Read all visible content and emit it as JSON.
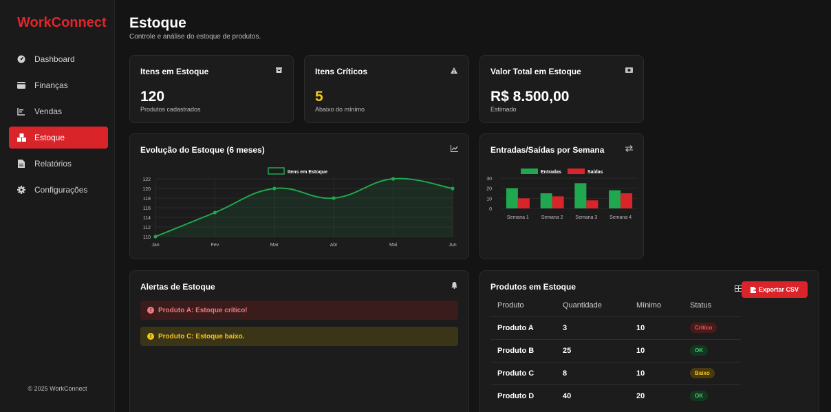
{
  "brand": "WorkConnect",
  "sidebar": {
    "items": [
      {
        "label": "Dashboard",
        "icon": "gauge-icon",
        "active": false
      },
      {
        "label": "Finanças",
        "icon": "wallet-icon",
        "active": false
      },
      {
        "label": "Vendas",
        "icon": "chart-icon",
        "active": false
      },
      {
        "label": "Estoque",
        "icon": "boxes-icon",
        "active": true
      },
      {
        "label": "Relatórios",
        "icon": "file-icon",
        "active": false
      },
      {
        "label": "Configurações",
        "icon": "gear-icon",
        "active": false
      }
    ],
    "footer": "© 2025 WorkConnect"
  },
  "header": {
    "title": "Estoque",
    "subtitle": "Controle e análise do estoque de produtos."
  },
  "kpis": [
    {
      "title": "Itens em Estoque",
      "value": "120",
      "sub": "Produtos cadastrados",
      "icon": "box-icon",
      "value_color": "#ffffff"
    },
    {
      "title": "Itens Críticos",
      "value": "5",
      "sub": "Abaixo do mínimo",
      "icon": "warning-icon",
      "value_color": "#f5c518"
    },
    {
      "title": "Valor Total em Estoque",
      "value": "R$ 8.500,00",
      "sub": "Estimado",
      "icon": "money-icon",
      "value_color": "#ffffff"
    }
  ],
  "evolution": {
    "title": "Evolução do Estoque (6 meses)",
    "icon": "line-chart-icon"
  },
  "weekly": {
    "title": "Entradas/Saídas por Semana",
    "icon": "exchange-icon"
  },
  "chart_data": [
    {
      "type": "area",
      "title": "Evolução do Estoque (6 meses)",
      "categories": [
        "Jan",
        "Fev",
        "Mar",
        "Abr",
        "Mai",
        "Jun"
      ],
      "series": [
        {
          "name": "Itens em Estoque",
          "values": [
            110,
            115,
            120,
            118,
            122,
            120
          ],
          "color": "#1fa84f"
        }
      ],
      "ylim": [
        110,
        122
      ],
      "yticks": [
        110,
        112,
        114,
        116,
        118,
        120,
        122
      ],
      "legend": "top-center",
      "grid": true
    },
    {
      "type": "bar",
      "title": "Entradas/Saídas por Semana",
      "categories": [
        "Semana 1",
        "Semana 2",
        "Semana 3",
        "Semana 4"
      ],
      "series": [
        {
          "name": "Entradas",
          "values": [
            20,
            15,
            25,
            18
          ],
          "color": "#1fa84f"
        },
        {
          "name": "Saídas",
          "values": [
            10,
            12,
            8,
            15
          ],
          "color": "#d9242a"
        }
      ],
      "ylim": [
        0,
        30
      ],
      "yticks": [
        0,
        10,
        20,
        30
      ],
      "legend": "top-center",
      "grid": true
    }
  ],
  "alerts": {
    "title": "Alertas de Estoque",
    "icon": "bell-icon",
    "items": [
      {
        "text": "Produto A: Estoque crítico!",
        "level": "critical"
      },
      {
        "text": "Produto C: Estoque baixo.",
        "level": "low"
      }
    ]
  },
  "products": {
    "title": "Produtos em Estoque",
    "icon": "table-icon",
    "export_label": "Exportar CSV",
    "columns": [
      "Produto",
      "Quantidade",
      "Mínimo",
      "Status"
    ],
    "rows": [
      {
        "name": "Produto A",
        "qty": "3",
        "min": "10",
        "status": "Crítico",
        "status_kind": "red"
      },
      {
        "name": "Produto B",
        "qty": "25",
        "min": "10",
        "status": "OK",
        "status_kind": "green"
      },
      {
        "name": "Produto C",
        "qty": "8",
        "min": "10",
        "status": "Baixo",
        "status_kind": "yellow"
      },
      {
        "name": "Produto D",
        "qty": "40",
        "min": "20",
        "status": "OK",
        "status_kind": "green"
      }
    ]
  }
}
